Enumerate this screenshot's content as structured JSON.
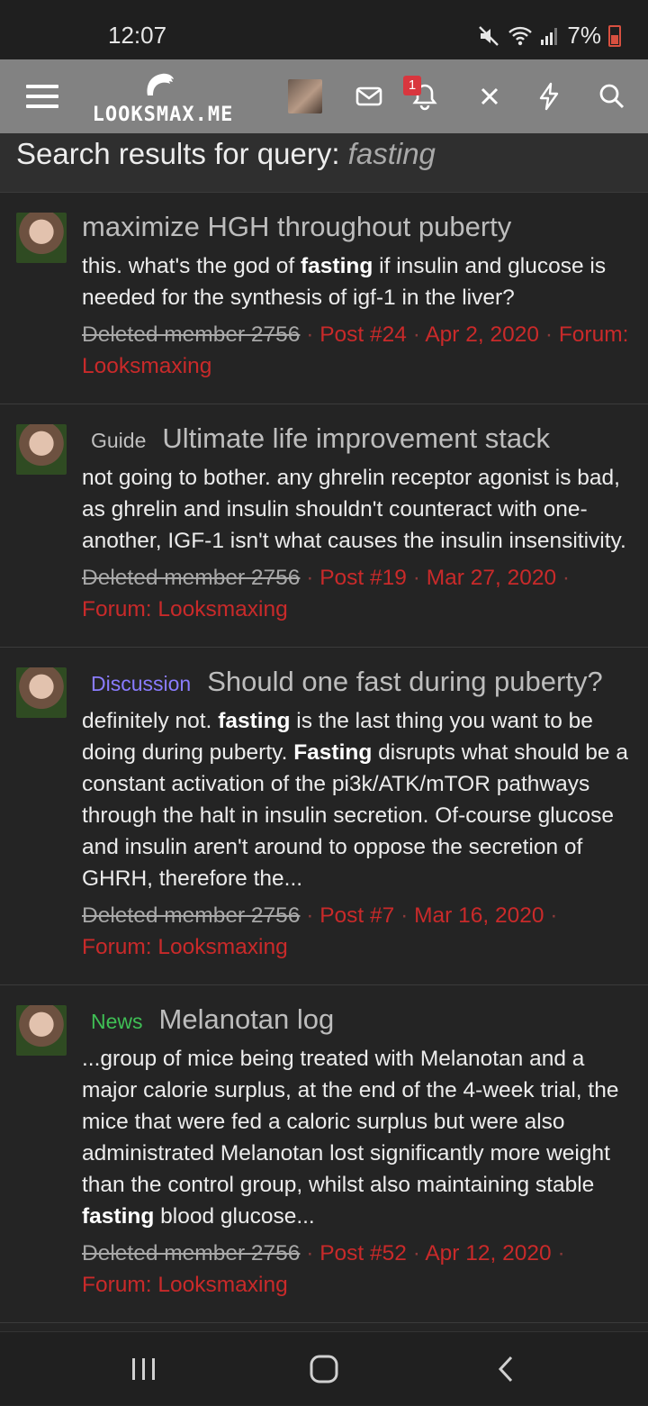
{
  "status": {
    "time": "12:07",
    "battery": "7%"
  },
  "app": {
    "logo_text": "LOOKSMAX.ME",
    "notification_count": "1"
  },
  "page": {
    "title_prefix": "Search results for query:",
    "query": "fasting"
  },
  "results": [
    {
      "prefix": "",
      "title": "maximize HGH throughout puberty",
      "snippet": [
        {
          "t": "this. what's the god of "
        },
        {
          "t": "fasting",
          "b": true
        },
        {
          "t": " if insulin and glucose is needed for the synthesis of igf-1 in the liver?"
        }
      ],
      "author": "Deleted member 2756",
      "post": "Post #24",
      "date": "Apr 2, 2020",
      "forum": "Forum: Looksmaxing"
    },
    {
      "prefix": "Guide",
      "prefix_kind": "guide",
      "title": "Ultimate life improvement stack",
      "snippet": [
        {
          "t": "not going to bother. any ghrelin receptor agonist is bad, as ghrelin and insulin shouldn't counteract with one-another, IGF-1 isn't what causes the insulin insensitivity."
        }
      ],
      "author": "Deleted member 2756",
      "post": "Post #19",
      "date": "Mar 27, 2020",
      "forum": "Forum: Looksmaxing"
    },
    {
      "prefix": "Discussion",
      "prefix_kind": "discussion",
      "title": "Should one fast during puberty?",
      "snippet": [
        {
          "t": "definitely not. "
        },
        {
          "t": "fasting",
          "b": true
        },
        {
          "t": " is the last thing you want to be doing during puberty. "
        },
        {
          "t": "Fasting",
          "b": true
        },
        {
          "t": " disrupts what should be a constant activation of the pi3k/ATK/mTOR pathways through the halt in insulin secretion. Of-course glucose and insulin aren't around to oppose the secretion of GHRH, therefore the..."
        }
      ],
      "author": "Deleted member 2756",
      "post": "Post #7",
      "date": "Mar 16, 2020",
      "forum": "Forum: Looksmaxing"
    },
    {
      "prefix": "News",
      "prefix_kind": "news",
      "title": "Melanotan log",
      "snippet": [
        {
          "t": "...group of mice being treated with Melanotan and a major calorie surplus, at the end of the 4-week trial, the mice that were fed a caloric surplus but were also administrated Melanotan lost significantly more weight than the control group, whilst also maintaining stable "
        },
        {
          "t": "fasting",
          "b": true
        },
        {
          "t": " blood glucose..."
        }
      ],
      "author": "Deleted member 2756",
      "post": "Post #52",
      "date": "Apr 12, 2020",
      "forum": "Forum: Looksmaxing"
    }
  ],
  "colors": {
    "background": "#242424",
    "app_bar": "#828282",
    "meta_red": "#c92a2a",
    "discussion": "#8a7cff",
    "news": "#3fbf55"
  },
  "icons": [
    "menu-icon",
    "mail-icon",
    "bell-icon",
    "close-icon",
    "bolt-icon",
    "search-icon",
    "recents-icon",
    "home-icon",
    "back-icon",
    "mute-icon",
    "wifi-icon",
    "signal-icon",
    "battery-icon"
  ]
}
